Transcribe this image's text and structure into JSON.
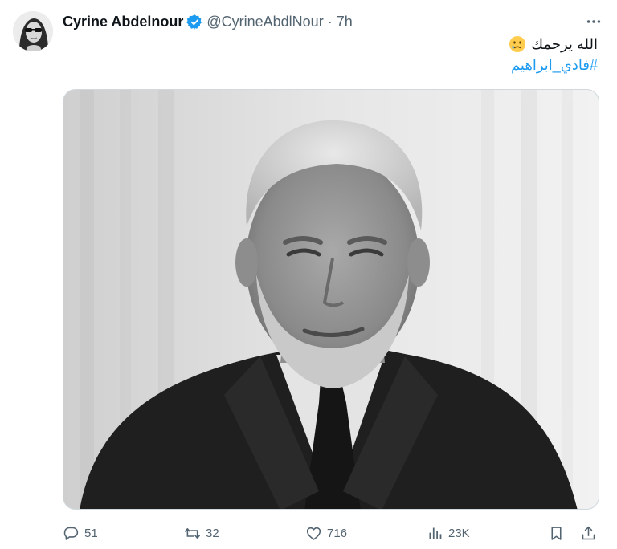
{
  "tweet": {
    "author_name": "Cyrine Abdelnour",
    "author_handle": "@CyrineAbdlNour",
    "separator": "·",
    "time": "7h",
    "text_line1": "الله يرحمك",
    "emoji": "crying-face",
    "hashtag": "#فادي_ابراهيم",
    "verified": true
  },
  "actions": {
    "replies": "51",
    "reposts": "32",
    "likes": "716",
    "views": "23K"
  },
  "colors": {
    "text_primary": "#0f1419",
    "text_secondary": "#536471",
    "link": "#1d9bf0",
    "verified_badge": "#1d9bf0"
  }
}
